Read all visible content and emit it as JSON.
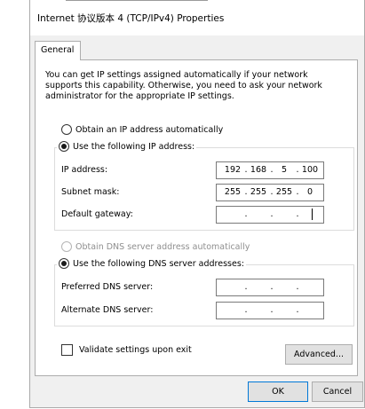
{
  "window": {
    "title": "Internet 协议版本 4 (TCP/IPv4) Properties"
  },
  "tabs": [
    {
      "label": "General"
    }
  ],
  "general": {
    "info_text": "You can get IP settings assigned automatically if your network supports this capability. Otherwise, you need to ask your network administrator for the appropriate IP settings.",
    "ip_auto_label": "Obtain an IP address automatically",
    "ip_manual_label": "Use the following IP address:",
    "ip_address_label": "IP address:",
    "subnet_label": "Subnet mask:",
    "gateway_label": "Default gateway:",
    "ip_address": [
      "192",
      "168",
      "5",
      "100"
    ],
    "subnet_mask": [
      "255",
      "255",
      "255",
      "0"
    ],
    "gateway": [
      "",
      "",
      "",
      ""
    ],
    "dns_auto_label": "Obtain DNS server address automatically",
    "dns_manual_label": "Use the following DNS server addresses:",
    "preferred_dns_label": "Preferred DNS server:",
    "alternate_dns_label": "Alternate DNS server:",
    "preferred_dns": [
      "",
      "",
      "",
      ""
    ],
    "alternate_dns": [
      "",
      "",
      "",
      ""
    ],
    "validate_label": "Validate settings upon exit",
    "advanced_button": "Advanced..."
  },
  "footer": {
    "ok_button": "OK",
    "cancel_button": "Cancel"
  }
}
